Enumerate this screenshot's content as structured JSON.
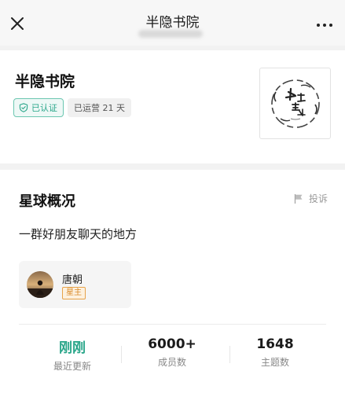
{
  "nav": {
    "title": "半隐书院",
    "close_icon": "close-icon",
    "more_icon": "more-dots-icon"
  },
  "header": {
    "name": "半隐书院",
    "verified_label": "已认证",
    "operating_days": "已运营 21 天",
    "accent": "#2aa68a"
  },
  "overview": {
    "title": "星球概况",
    "report_label": "投诉",
    "description": "一群好朋友聊天的地方",
    "owner": {
      "name": "唐朝",
      "role": "星主"
    }
  },
  "stats": [
    {
      "value": "刚刚",
      "label": "最近更新"
    },
    {
      "value": "6000+",
      "label": "成员数"
    },
    {
      "value": "1648",
      "label": "主题数"
    }
  ]
}
